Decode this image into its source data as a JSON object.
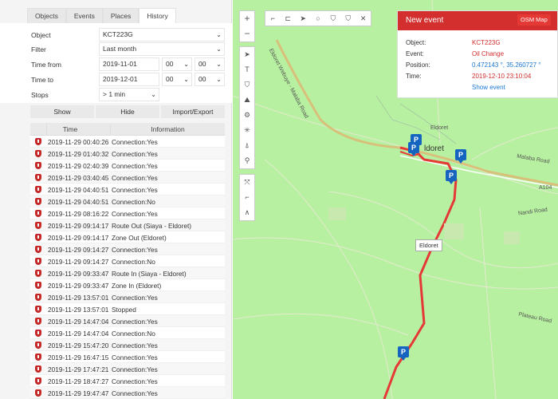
{
  "tabs": [
    "Objects",
    "Events",
    "Places",
    "History"
  ],
  "form": {
    "object_label": "Object",
    "object_value": "KCT223G",
    "filter_label": "Filter",
    "filter_value": "Last month",
    "time_from_label": "Time from",
    "time_from_date": "2019-11-01",
    "time_from_h": "00",
    "time_from_m": "00",
    "time_to_label": "Time to",
    "time_to_date": "2019-12-01",
    "time_to_h": "00",
    "time_to_m": "00",
    "stops_label": "Stops",
    "stops_value": "> 1 min"
  },
  "buttons": {
    "show": "Show",
    "hide": "Hide",
    "import_export": "Import/Export"
  },
  "grid": {
    "col_time": "Time",
    "col_info": "Information",
    "rows": [
      [
        "2019-11-29 00:40:26",
        "Connection:Yes"
      ],
      [
        "2019-11-29 01:40:32",
        "Connection:Yes"
      ],
      [
        "2019-11-29 02:40:39",
        "Connection:Yes"
      ],
      [
        "2019-11-29 03:40:45",
        "Connection:Yes"
      ],
      [
        "2019-11-29 04:40:51",
        "Connection:Yes"
      ],
      [
        "2019-11-29 04:40:51",
        "Connection:No"
      ],
      [
        "2019-11-29 08:16:22",
        "Connection:Yes"
      ],
      [
        "2019-11-29 09:14:17",
        "Route Out (Siaya - Eldoret)"
      ],
      [
        "2019-11-29 09:14:17",
        "Zone Out (Eldoret)"
      ],
      [
        "2019-11-29 09:14:27",
        "Connection:Yes"
      ],
      [
        "2019-11-29 09:14:27",
        "Connection:No"
      ],
      [
        "2019-11-29 09:33:47",
        "Route In (Siaya - Eldoret)"
      ],
      [
        "2019-11-29 09:33:47",
        "Zone In (Eldoret)"
      ],
      [
        "2019-11-29 13:57:01",
        "Connection:Yes"
      ],
      [
        "2019-11-29 13:57:01",
        "Stopped"
      ],
      [
        "2019-11-29 14:47:04",
        "Connection:Yes"
      ],
      [
        "2019-11-29 14:47:04",
        "Connection:No"
      ],
      [
        "2019-11-29 15:47:20",
        "Connection:Yes"
      ],
      [
        "2019-11-29 16:47:15",
        "Connection:Yes"
      ],
      [
        "2019-11-29 17:47:21",
        "Connection:Yes"
      ],
      [
        "2019-11-29 18:47:27",
        "Connection:Yes"
      ],
      [
        "2019-11-29 19:47:47",
        "Connection:Yes"
      ]
    ]
  },
  "popup": {
    "title": "New event",
    "osm_label": "OSM Map",
    "object_key": "Object:",
    "object_val": "KCT223G",
    "event_key": "Event:",
    "event_val": "Oil Change",
    "position_key": "Position:",
    "position_val": "0.472143 °, 35.260727 °",
    "time_key": "Time:",
    "time_val": "2019-12-10 23:10:04",
    "show_event": "Show event"
  },
  "map": {
    "town_label": "Eldoret",
    "town_label_big": "ldoret",
    "callout": "Eldoret",
    "roads": [
      "Eldoret Webuye - Malaba Road",
      "Malaba Road",
      "A104",
      "Nandi Road",
      "Plateau Road"
    ]
  }
}
